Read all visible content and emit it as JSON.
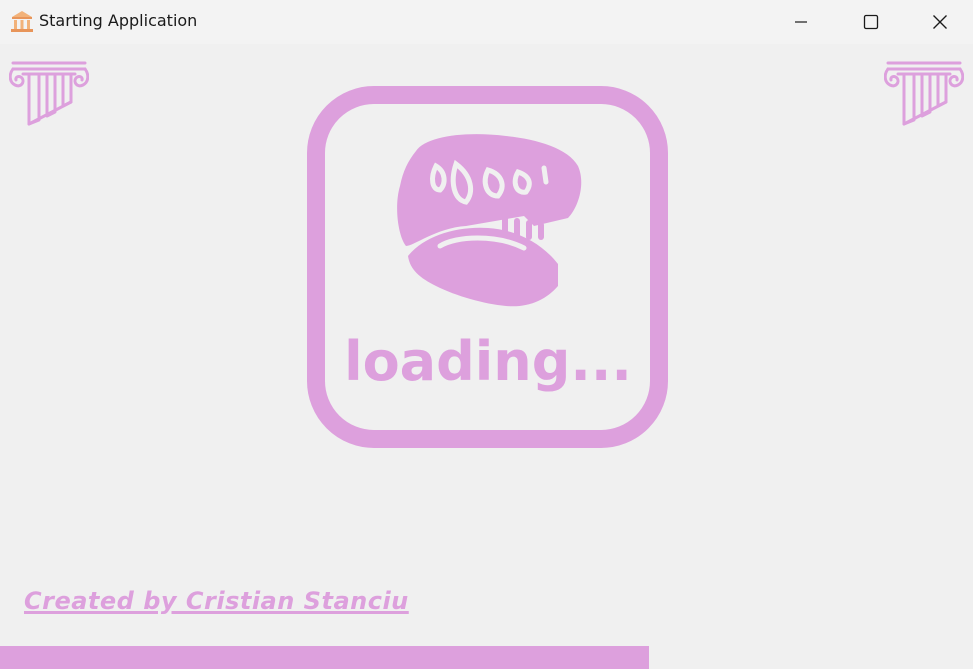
{
  "window": {
    "title": "Starting Application",
    "controls": {
      "minimize": "minimize",
      "maximize": "maximize",
      "close": "close"
    }
  },
  "splash": {
    "loading_text": "loading...",
    "credit_text": "Created by Cristian Stanciu",
    "progress_fraction": 0.667
  },
  "colors": {
    "accent": "#dda0dd",
    "background": "#f0f0f0",
    "titlebar": "#f3f3f3",
    "app_icon": "#f2b27a"
  },
  "icons": {
    "app": "museum-building-icon",
    "decor": "ionic-column-icon",
    "logo": "dinosaur-skull-icon"
  }
}
